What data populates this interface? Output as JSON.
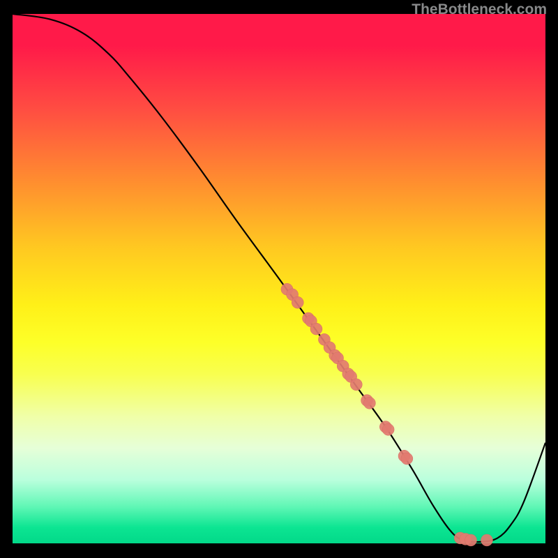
{
  "watermark": "TheBottleneck.com",
  "colors": {
    "curve": "#000000",
    "dot_fill": "#e27b70",
    "dot_stroke": "#d66b60",
    "background_top": "#ff1a49",
    "background_bottom": "#02d989"
  },
  "chart_data": {
    "type": "line",
    "title": "",
    "xlabel": "",
    "ylabel": "",
    "xlim": [
      0,
      100
    ],
    "ylim": [
      0,
      100
    ],
    "grid": false,
    "note": "x/y are normalized 0-100 of plot area; y=0 is bottom (green), y=100 is top (red). Curve falls from top-left, bottoms out near x~87, then rises.",
    "curve": [
      {
        "x": 0,
        "y": 100
      },
      {
        "x": 7,
        "y": 99
      },
      {
        "x": 13,
        "y": 96.5
      },
      {
        "x": 18,
        "y": 92.5
      },
      {
        "x": 22,
        "y": 88
      },
      {
        "x": 28,
        "y": 80.5
      },
      {
        "x": 35,
        "y": 71
      },
      {
        "x": 42,
        "y": 61
      },
      {
        "x": 50,
        "y": 50
      },
      {
        "x": 55,
        "y": 43
      },
      {
        "x": 60,
        "y": 36
      },
      {
        "x": 65,
        "y": 29
      },
      {
        "x": 70,
        "y": 22
      },
      {
        "x": 75,
        "y": 14
      },
      {
        "x": 79,
        "y": 7
      },
      {
        "x": 82.5,
        "y": 2
      },
      {
        "x": 85,
        "y": 0.5
      },
      {
        "x": 88,
        "y": 0.3
      },
      {
        "x": 91,
        "y": 1
      },
      {
        "x": 93.5,
        "y": 3.5
      },
      {
        "x": 96,
        "y": 8
      },
      {
        "x": 100,
        "y": 19
      }
    ],
    "points": [
      {
        "x": 51.5,
        "y": 48
      },
      {
        "x": 52.5,
        "y": 47
      },
      {
        "x": 53.5,
        "y": 45.5
      },
      {
        "x": 55.5,
        "y": 42.5
      },
      {
        "x": 56.0,
        "y": 42
      },
      {
        "x": 57.0,
        "y": 40.5
      },
      {
        "x": 58.5,
        "y": 38.5
      },
      {
        "x": 59.5,
        "y": 37
      },
      {
        "x": 60.5,
        "y": 35.5
      },
      {
        "x": 61.0,
        "y": 35
      },
      {
        "x": 62.0,
        "y": 33.5
      },
      {
        "x": 63.0,
        "y": 32
      },
      {
        "x": 63.5,
        "y": 31.5
      },
      {
        "x": 64.5,
        "y": 30
      },
      {
        "x": 66.5,
        "y": 27
      },
      {
        "x": 67.0,
        "y": 26.5
      },
      {
        "x": 70.0,
        "y": 22
      },
      {
        "x": 70.5,
        "y": 21.5
      },
      {
        "x": 73.5,
        "y": 16.5
      },
      {
        "x": 74.0,
        "y": 16
      },
      {
        "x": 84.0,
        "y": 1
      },
      {
        "x": 85.0,
        "y": 0.8
      },
      {
        "x": 86.0,
        "y": 0.6
      },
      {
        "x": 89.0,
        "y": 0.6
      }
    ]
  }
}
